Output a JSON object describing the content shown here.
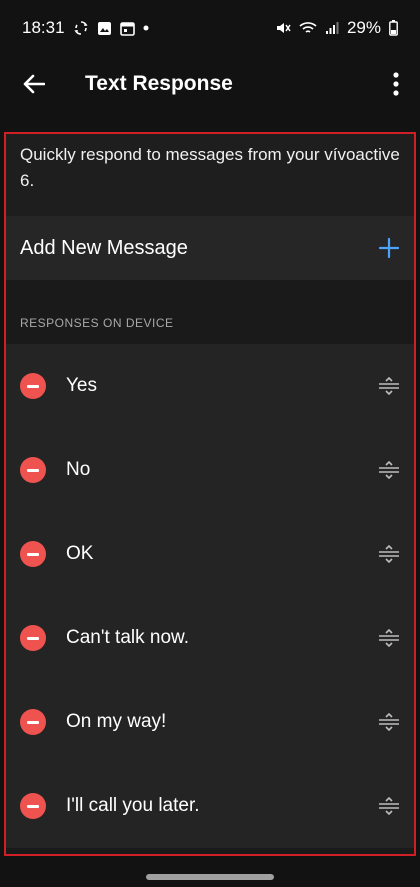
{
  "status": {
    "time": "18:31",
    "battery": "29%"
  },
  "appbar": {
    "title": "Text Response"
  },
  "intro": {
    "text": "Quickly respond to messages from your vívoactive 6."
  },
  "add": {
    "label": "Add New Message"
  },
  "section": {
    "header": "RESPONSES ON DEVICE"
  },
  "responses": [
    {
      "label": "Yes"
    },
    {
      "label": "No"
    },
    {
      "label": "OK"
    },
    {
      "label": "Can't talk now."
    },
    {
      "label": "On my way!"
    },
    {
      "label": "I'll call you later."
    }
  ],
  "colors": {
    "accent": "#4aa3ff",
    "remove": "#ef5350",
    "highlight_border": "#d11f26"
  },
  "icons": {
    "back": "arrow-left-icon",
    "more": "more-vertical-icon",
    "add": "plus-icon",
    "remove": "remove-circle-icon",
    "drag": "drag-handle-icon"
  }
}
